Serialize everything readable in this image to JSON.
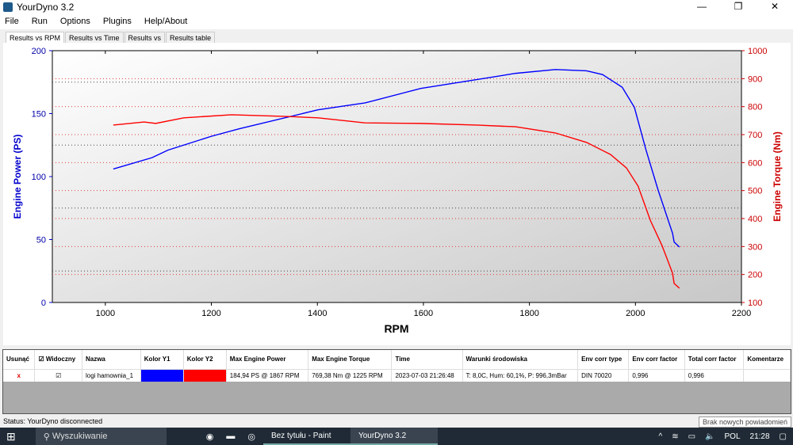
{
  "window": {
    "title": "YourDyno 3.2",
    "controls": [
      "—",
      "❐",
      "✕"
    ]
  },
  "menu": [
    "File",
    "Run",
    "Options",
    "Plugins",
    "Help/About"
  ],
  "tabs": [
    "Results vs RPM",
    "Results vs Time",
    "Results vs",
    "Results table"
  ],
  "chart_data": {
    "type": "line",
    "xlabel": "RPM",
    "ylabel": "Engine Power (PS)",
    "y2label": "Engine Torque (Nm)",
    "xlim": [
      900,
      2200
    ],
    "ylim": [
      0,
      200
    ],
    "y2lim": [
      100,
      1000
    ],
    "xticks": [
      1000,
      1200,
      1400,
      1600,
      1800,
      2000,
      2200
    ],
    "yticks": [
      0,
      50,
      100,
      150,
      200
    ],
    "y2ticks": [
      100,
      200,
      300,
      400,
      500,
      600,
      700,
      800,
      900,
      1000
    ],
    "grid": true,
    "series": [
      {
        "axis": "y1",
        "color": "#0000ff",
        "x": [
          1015,
          1088,
          1118,
          1200,
          1253,
          1401,
          1490,
          1595,
          1700,
          1774,
          1849,
          1908,
          1938,
          1975,
          1998,
          2020,
          2043,
          2070,
          2073,
          2083
        ],
        "y": [
          106,
          115,
          121,
          132,
          138,
          153,
          158.5,
          170,
          177,
          182,
          185,
          184,
          181,
          171,
          155,
          121,
          89,
          55,
          48,
          44
        ]
      },
      {
        "axis": "y2",
        "color": "#ff0000",
        "x": [
          1015,
          1073,
          1095,
          1148,
          1238,
          1342,
          1401,
          1490,
          1595,
          1700,
          1774,
          1849,
          1908,
          1953,
          1983,
          2005,
          2028,
          2050,
          2070,
          2073,
          2083
        ],
        "y": [
          734,
          745,
          740,
          760,
          771,
          765,
          760,
          742,
          740,
          734,
          728,
          706,
          672,
          629,
          581,
          516,
          394,
          304,
          205,
          168,
          151
        ]
      }
    ]
  },
  "results": {
    "headers": [
      "Usunąć",
      "Widoczny",
      "Nazwa",
      "Kolor Y1",
      "Kolor Y2",
      "Max Engine Power",
      "Max Engine Torque",
      "Time",
      "Warunki środowiska",
      "Env corr type",
      "Env corr factor",
      "Total corr factor",
      "Komentarze"
    ],
    "row": {
      "delete": "x",
      "name": "logi hamownia_1",
      "color_y1": "#0000ff",
      "color_y2": "#ff0000",
      "max_power": "184,94 PS @ 1867 RPM",
      "max_torque": "769,38 Nm @ 1225 RPM",
      "time": "2023-07-03 21:26:48",
      "conditions": "T: 8,0C, Hum: 60,1%, P: 996,3mBar",
      "env_corr_type": "DIN 70020",
      "env_corr_factor": "0,996",
      "total_corr_factor": "0,996",
      "comment": ""
    }
  },
  "status": "Status: YourDyno disconnected",
  "notification": "Brak nowych powiadomień",
  "taskbar": {
    "search": "Wyszukiwanie",
    "apps": [
      "Bez tytułu - Paint",
      "YourDyno 3.2"
    ],
    "lang": "POL",
    "time": "21:28"
  }
}
